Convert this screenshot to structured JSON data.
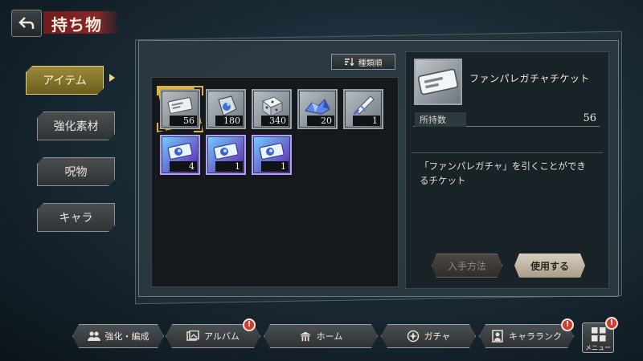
{
  "header": {
    "title": "持ち物",
    "back_icon": "back-arrow-icon"
  },
  "tabs": [
    {
      "label": "アイテム",
      "active": true
    },
    {
      "label": "強化素材",
      "active": false
    },
    {
      "label": "呪物",
      "active": false
    },
    {
      "label": "キャラ",
      "active": false
    }
  ],
  "sort": {
    "label": "種類順",
    "icon": "sort-icon"
  },
  "items": [
    {
      "icon": "ticket-icon",
      "count": "56",
      "rarity": "normal",
      "selected": true
    },
    {
      "icon": "tag-icon",
      "count": "180",
      "rarity": "normal",
      "selected": false
    },
    {
      "icon": "dice-box-icon",
      "count": "340",
      "rarity": "normal",
      "selected": false
    },
    {
      "icon": "crystal-ore-icon",
      "count": "20",
      "rarity": "normal",
      "selected": false
    },
    {
      "icon": "sword-icon",
      "count": "1",
      "rarity": "normal",
      "selected": false
    },
    {
      "icon": "rare-ticket-icon",
      "count": "4",
      "rarity": "rare",
      "selected": false
    },
    {
      "icon": "rare-ticket-icon",
      "count": "1",
      "rarity": "rare",
      "selected": false
    },
    {
      "icon": "rare-ticket-icon",
      "count": "1",
      "rarity": "rare",
      "selected": false
    }
  ],
  "detail": {
    "name": "ファンパレガチャチケット",
    "owned_label": "所持数",
    "owned_value": "56",
    "description_line1": "「ファンパレガチャ」を引くことができ",
    "description_line2": "るチケット",
    "acquire_label": "入手方法",
    "use_label": "使用する"
  },
  "bottom_nav": [
    {
      "label": "強化・編成",
      "icon": "people-icon",
      "badge": false
    },
    {
      "label": "アルバム",
      "icon": "album-icon",
      "badge": true
    },
    {
      "label": "ホーム",
      "icon": "home-icon",
      "badge": false
    },
    {
      "label": "ガチャ",
      "icon": "gacha-icon",
      "badge": false
    },
    {
      "label": "キャラランク",
      "icon": "portrait-icon",
      "badge": true
    }
  ],
  "menu": {
    "label": "メニュー",
    "badge": true,
    "badge_text": "!"
  },
  "colors": {
    "active_tab": "#9b8a3a",
    "selector": "#e4b52c",
    "badge": "#d63a2c",
    "rare_slot": "#6850c8"
  }
}
